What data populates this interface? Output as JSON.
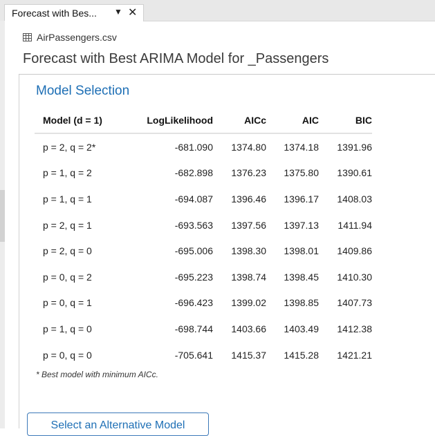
{
  "tab": {
    "title": "Forecast with Bes...",
    "dropdown_glyph": "▼",
    "close_glyph": "✕"
  },
  "source": {
    "icon": "table-grid-icon",
    "label": "AirPassengers.csv"
  },
  "report_title": "Forecast with Best ARIMA Model for _Passengers",
  "section_title": "Model Selection",
  "table": {
    "headers": [
      "Model (d = 1)",
      "LogLikelihood",
      "AICc",
      "AIC",
      "BIC"
    ],
    "rows": [
      {
        "model": "p = 2, q = 2*",
        "loglik": "-681.090",
        "aicc": "1374.80",
        "aic": "1374.18",
        "bic": "1391.96"
      },
      {
        "model": "p = 1, q = 2",
        "loglik": "-682.898",
        "aicc": "1376.23",
        "aic": "1375.80",
        "bic": "1390.61"
      },
      {
        "model": "p = 1, q = 1",
        "loglik": "-694.087",
        "aicc": "1396.46",
        "aic": "1396.17",
        "bic": "1408.03"
      },
      {
        "model": "p = 2, q = 1",
        "loglik": "-693.563",
        "aicc": "1397.56",
        "aic": "1397.13",
        "bic": "1411.94"
      },
      {
        "model": "p = 2, q = 0",
        "loglik": "-695.006",
        "aicc": "1398.30",
        "aic": "1398.01",
        "bic": "1409.86"
      },
      {
        "model": "p = 0, q = 2",
        "loglik": "-695.223",
        "aicc": "1398.74",
        "aic": "1398.45",
        "bic": "1410.30"
      },
      {
        "model": "p = 0, q = 1",
        "loglik": "-696.423",
        "aicc": "1399.02",
        "aic": "1398.85",
        "bic": "1407.73"
      },
      {
        "model": "p = 1, q = 0",
        "loglik": "-698.744",
        "aicc": "1403.66",
        "aic": "1403.49",
        "bic": "1412.38"
      },
      {
        "model": "p = 0, q = 0",
        "loglik": "-705.641",
        "aicc": "1415.37",
        "aic": "1415.28",
        "bic": "1421.21"
      }
    ]
  },
  "footnote": "* Best model with minimum AICc.",
  "alt_button_label": "Select an Alternative Model",
  "colors": {
    "accent": "#1e6fb5",
    "tabstrip": "#e8e8e8",
    "button_border": "#3b78b8"
  }
}
